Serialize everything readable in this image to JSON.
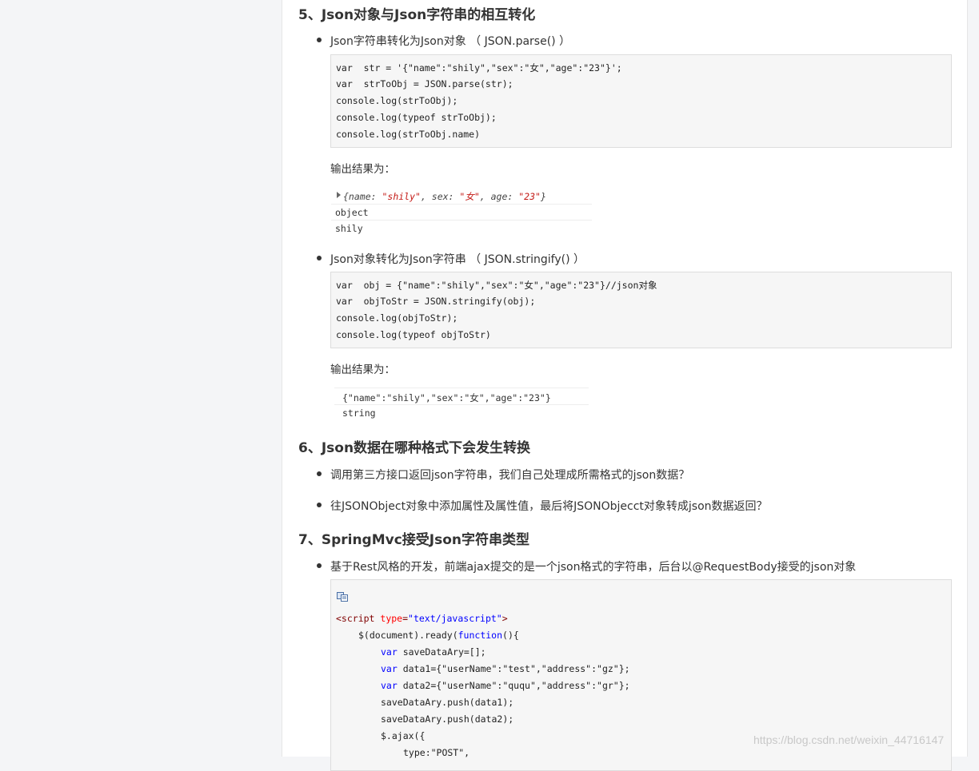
{
  "sections": {
    "s5": {
      "title": "5、Json对象与Json字符串的相互转化",
      "item1": "Json字符串转化为Json对象 （ JSON.parse() ）",
      "code1": [
        "var  str = '{\"name\":\"shily\",\"sex\":\"女\",\"age\":\"23\"}';",
        "var  strToObj = JSON.parse(str);",
        "console.log(strToObj);",
        "console.log(typeof strToObj);",
        "console.log(strToObj.name)"
      ],
      "output_label1": "输出结果为：",
      "output1": {
        "obj_prefix": "{name: ",
        "name_val": "\"shily\"",
        "mid1": ", sex: ",
        "sex_val": "\"女\"",
        "mid2": ", age: ",
        "age_val": "\"23\"",
        "suffix": "}",
        "line2": "object",
        "line3": "shily"
      },
      "item2": "Json对象转化为Json字符串 （ JSON.stringify() ）",
      "code2": [
        "var  obj = {\"name\":\"shily\",\"sex\":\"女\",\"age\":\"23\"}//json对象",
        "var  objToStr = JSON.stringify(obj);",
        "console.log(objToStr);",
        "console.log(typeof objToStr)"
      ],
      "output_label2": "输出结果为：",
      "output2": {
        "line1": "{\"name\":\"shily\",\"sex\":\"女\",\"age\":\"23\"}",
        "line2": "string"
      }
    },
    "s6": {
      "title": "6、Json数据在哪种格式下会发生转换",
      "item1": "调用第三方接口返回json字符串，我们自己处理成所需格式的json数据？",
      "item2": " 往JSONObject对象中添加属性及属性值，最后将JSONObjecct对象转成json数据返回？"
    },
    "s7": {
      "title": "7、SpringMvc接受Json字符串类型",
      "item1": "基于Rest风格的开发，前端ajax提交的是一个json格式的字符串，后台以@RequestBody接受的json对象",
      "code": {
        "l1_tag_open": "<script ",
        "l1_attr": "type",
        "l1_eq": "=",
        "l1_val": "\"text/javascript\"",
        "l1_close": ">",
        "l2_a": "$(document).ready(",
        "l2_kw": "function",
        "l2_b": "(){",
        "l3_kw": "var",
        "l3_rest": " saveDataAry=[];",
        "l4_kw": "var",
        "l4_rest": " data1={\"userName\":\"test\",\"address\":\"gz\"};",
        "l5_kw": "var",
        "l5_rest": " data2={\"userName\":\"ququ\",\"address\":\"gr\"};",
        "l6": "saveDataAry.push(data1);",
        "l7": "saveDataAry.push(data2);",
        "l8": "$.ajax({",
        "l9": "type:\"POST\","
      }
    }
  },
  "watermark": "https://blog.csdn.net/weixin_44716147"
}
